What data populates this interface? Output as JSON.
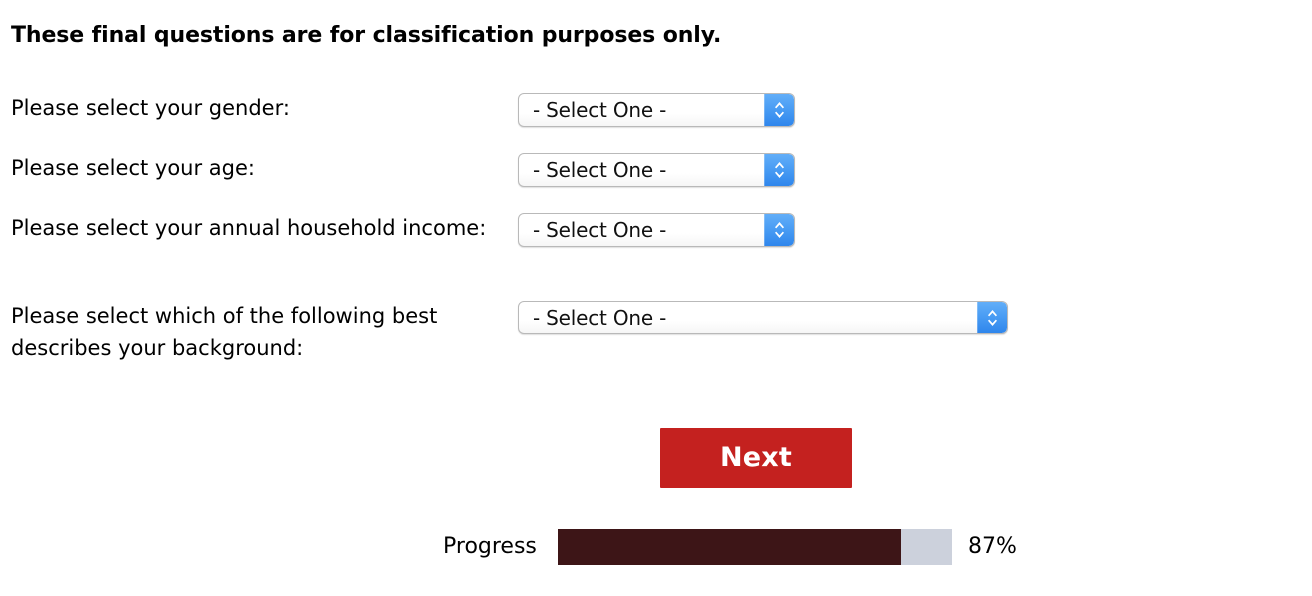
{
  "heading": "These final questions are for classification purposes only.",
  "questions": [
    {
      "label": "Please select your gender:",
      "select": {
        "value": "- Select One -",
        "name": "gender-select",
        "stepper_icon": "up-down-chevron-icon"
      }
    },
    {
      "label": "Please select your age:",
      "select": {
        "value": "- Select One -",
        "name": "age-select",
        "stepper_icon": "up-down-chevron-icon"
      }
    },
    {
      "label": "Please select your annual household income:",
      "select": {
        "value": "- Select One -",
        "name": "income-select",
        "stepper_icon": "up-down-chevron-icon"
      }
    },
    {
      "label": "Please select which of the following best describes your background:",
      "select": {
        "value": "- Select One -",
        "name": "background-select",
        "stepper_icon": "up-down-chevron-icon"
      }
    }
  ],
  "next_button": {
    "label": "Next"
  },
  "progress": {
    "label": "Progress",
    "percent_text": "87%",
    "percent_value": 87
  },
  "colors": {
    "button_red": "#c4211f",
    "progress_fill": "#3d1517",
    "progress_track": "#ccd1dc",
    "stepper_blue": "#2f86ec"
  }
}
